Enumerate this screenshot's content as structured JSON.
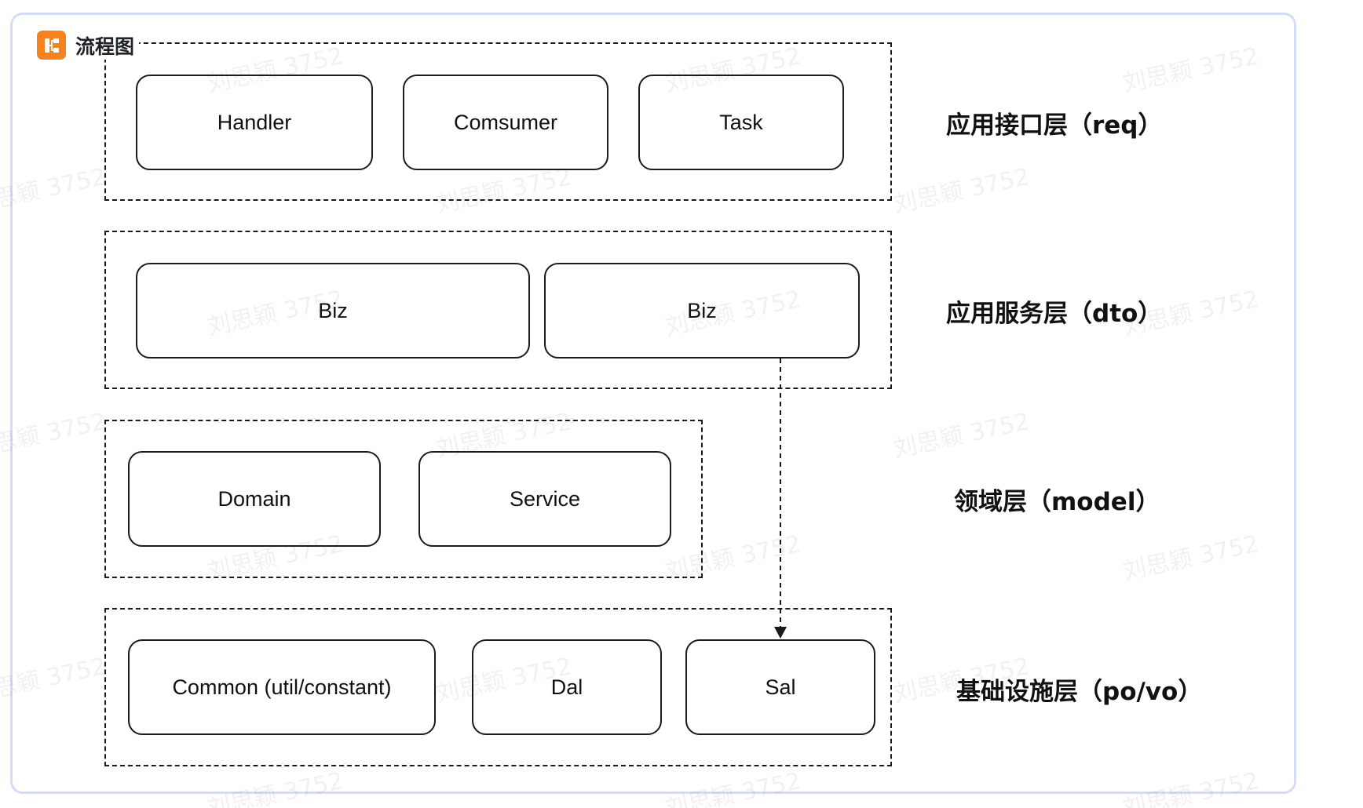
{
  "header": {
    "icon": "flowchart-icon",
    "title": "流程图"
  },
  "colors": {
    "frame_border": "#d5dcf6",
    "header_icon_bg": "#f5821f",
    "stroke": "#1a1a1a"
  },
  "layers": [
    {
      "label": "应用接口层（req）",
      "nodes": [
        "Handler",
        "Comsumer",
        "Task"
      ]
    },
    {
      "label": "应用服务层（dto）",
      "nodes": [
        "Biz",
        "Biz"
      ]
    },
    {
      "label": "领域层（model）",
      "nodes": [
        "Domain",
        "Service"
      ]
    },
    {
      "label": "基础设施层（po/vo）",
      "nodes": [
        "Common (util/constant)",
        "Dal",
        "Sal"
      ]
    }
  ],
  "edges": [
    {
      "from": "Biz",
      "to": "Sal",
      "style": "dashed-arrow"
    }
  ],
  "watermark_text": "刘思颖 3752"
}
